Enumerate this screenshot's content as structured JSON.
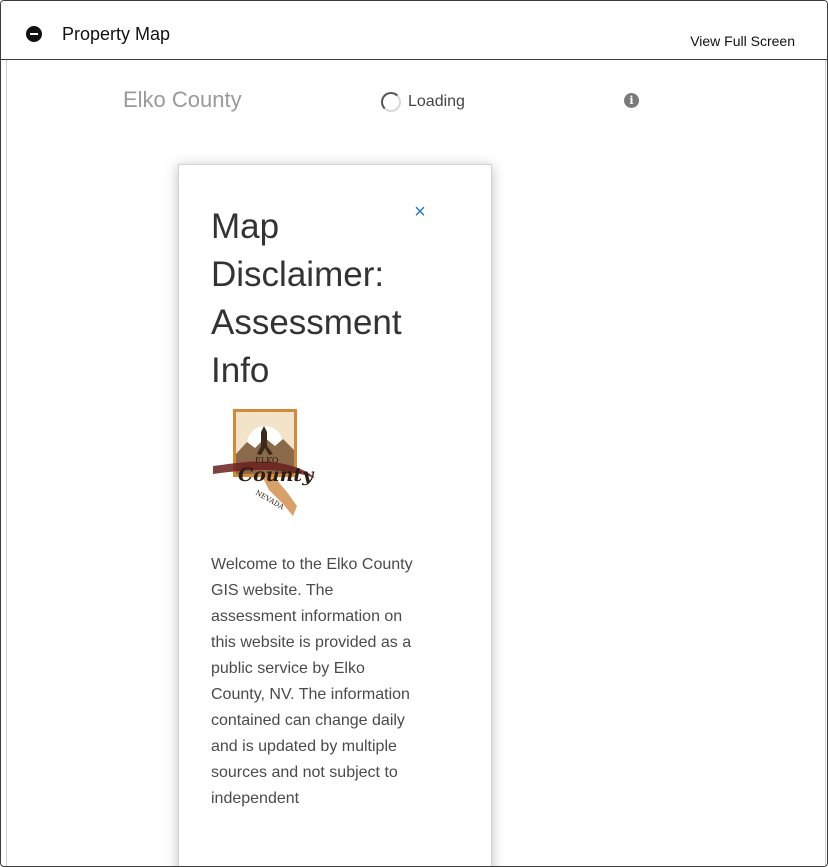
{
  "header": {
    "title": "Property Map",
    "fullscreen_label": "View Full Screen"
  },
  "map": {
    "title": "Elko County",
    "loading_label": "Loading",
    "info_icon": "info-icon"
  },
  "dialog": {
    "title": "Map Disclaimer: Assessment Info",
    "close_icon": "close-icon",
    "logo": {
      "line1": "ELKO",
      "line2": "County",
      "line3": "NEVADA"
    },
    "body": "Welcome to the Elko County GIS website. The assessment information on this website is provided as a public service by Elko County, NV. The information contained can change daily and is updated by multiple sources and not subject to independent"
  },
  "colors": {
    "accent": "#2b7bb9",
    "logo_orange": "#c8792a",
    "logo_maroon": "#6b1f1f"
  }
}
